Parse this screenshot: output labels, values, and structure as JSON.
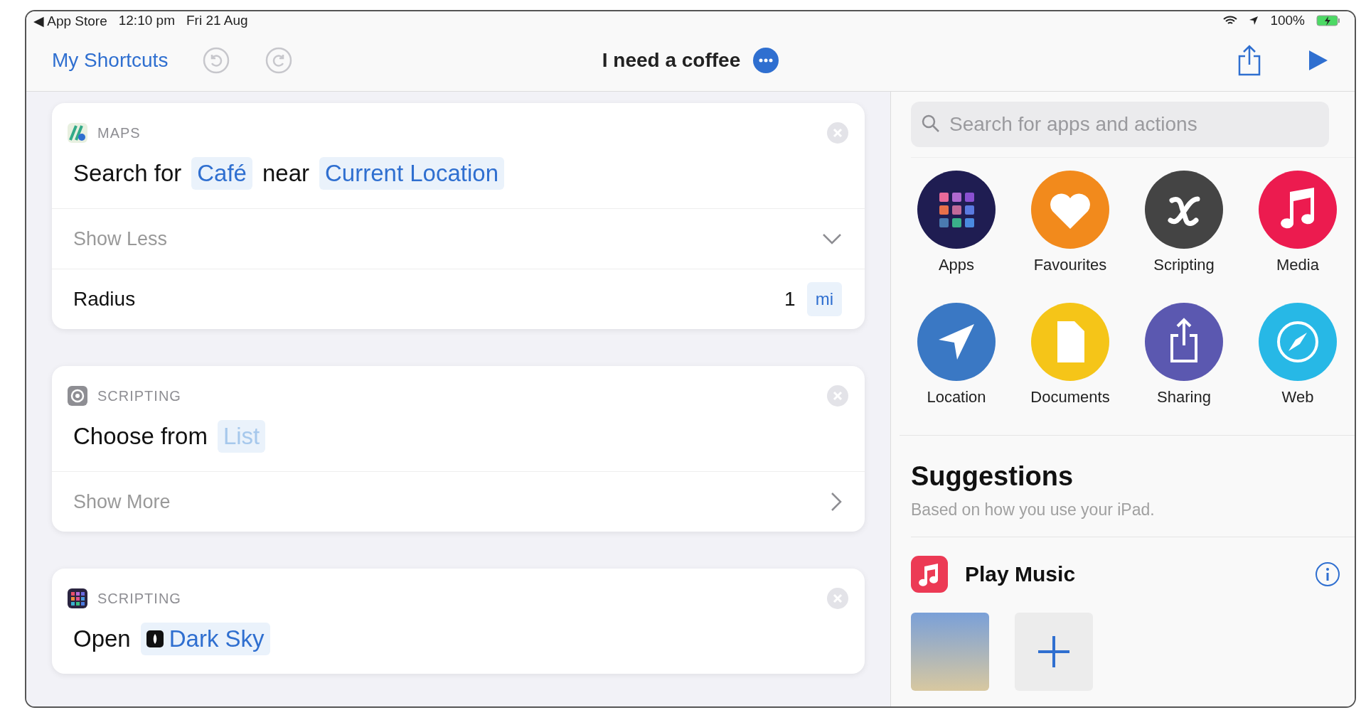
{
  "status_bar": {
    "back_app": "◀ App Store",
    "time": "12:10 pm",
    "date": "Fri 21 Aug",
    "battery": "100%"
  },
  "nav": {
    "back": "My Shortcuts",
    "title": "I need a coffee"
  },
  "actions": [
    {
      "kind": "maps",
      "app": "MAPS",
      "parts": [
        {
          "kind": "text",
          "text": "Search for"
        },
        {
          "kind": "token",
          "text": "Café"
        },
        {
          "kind": "text",
          "text": "near"
        },
        {
          "kind": "token",
          "text": "Current Location"
        }
      ],
      "toggle": {
        "label": "Show Less",
        "expanded": true
      },
      "params": [
        {
          "label": "Radius",
          "value": "1",
          "unit": "mi"
        }
      ]
    },
    {
      "kind": "gear",
      "app": "SCRIPTING",
      "parts": [
        {
          "kind": "text",
          "text": "Choose from"
        },
        {
          "kind": "placeholder",
          "text": "List"
        }
      ],
      "toggle": {
        "label": "Show More",
        "expanded": false
      }
    },
    {
      "kind": "grid",
      "app": "SCRIPTING",
      "parts": [
        {
          "kind": "text",
          "text": "Open"
        },
        {
          "kind": "app",
          "text": "Dark Sky"
        }
      ]
    }
  ],
  "search": {
    "placeholder": "Search for apps and actions"
  },
  "categories": [
    {
      "label": "Apps",
      "kind": "grid",
      "color": "#1f1d52"
    },
    {
      "label": "Favourites",
      "kind": "heart",
      "color": "#f28a1c"
    },
    {
      "label": "Scripting",
      "kind": "variable",
      "color": "#444444"
    },
    {
      "label": "Media",
      "kind": "note",
      "color": "#ec1b4f"
    },
    {
      "label": "Location",
      "kind": "arrow",
      "color": "#3a78c4"
    },
    {
      "label": "Documents",
      "kind": "doc",
      "color": "#f5c518"
    },
    {
      "label": "Sharing",
      "kind": "share",
      "color": "#5b58b0"
    },
    {
      "label": "Web",
      "kind": "compass",
      "color": "#27b8e6"
    }
  ],
  "suggestions": {
    "title": "Suggestions",
    "subtitle": "Based on how you use your iPad.",
    "items": [
      {
        "title": "Play Music",
        "tiles": [
          {
            "kind": "photo"
          },
          {
            "kind": "add"
          }
        ]
      }
    ]
  }
}
